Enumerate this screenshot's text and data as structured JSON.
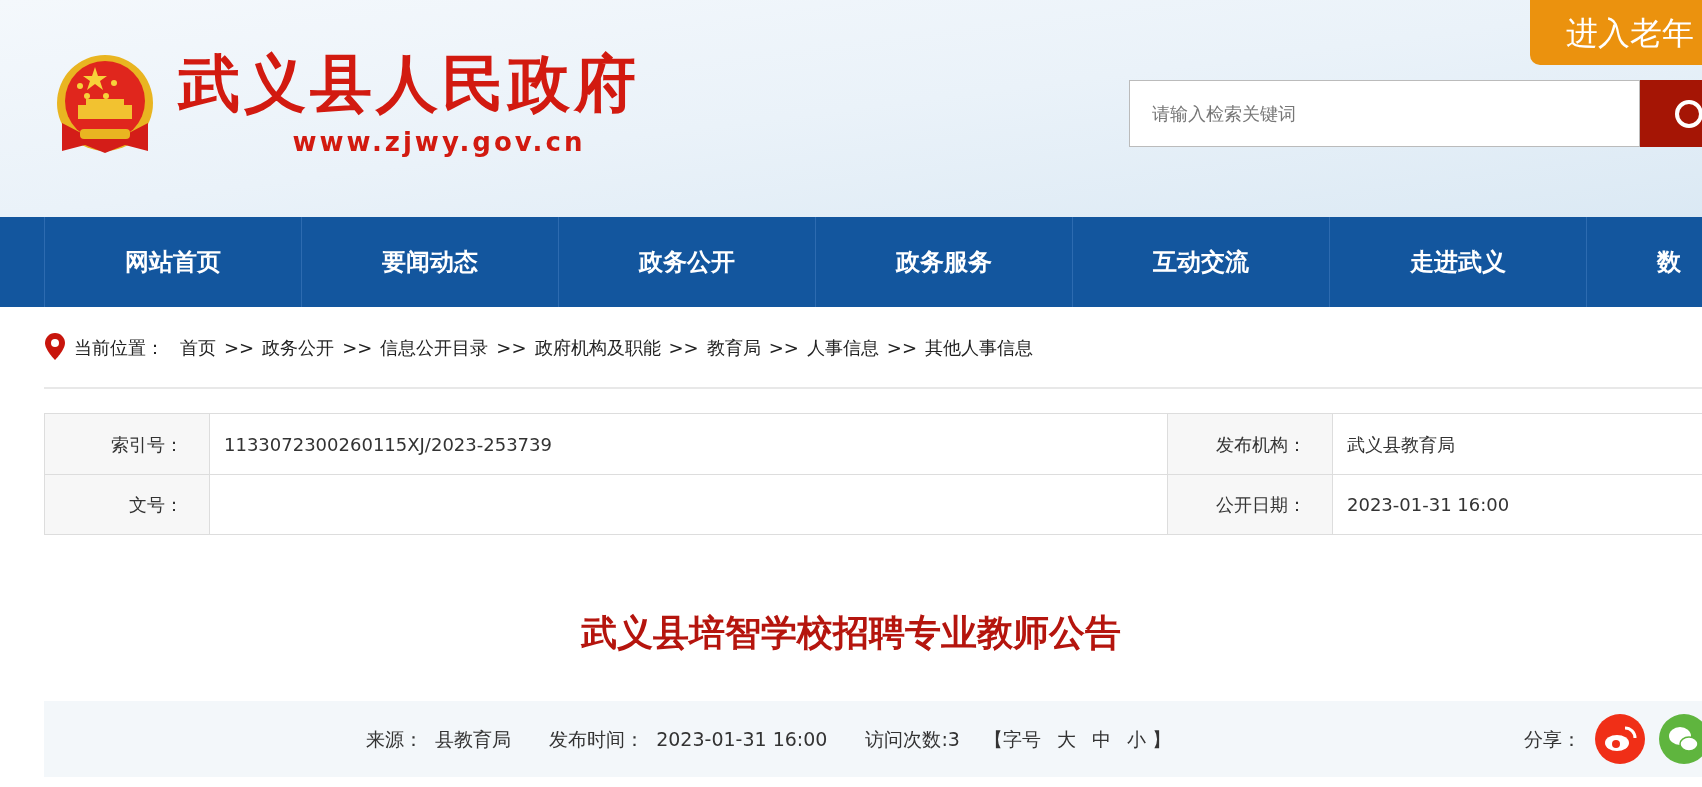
{
  "header": {
    "site_title": "武义县人民政府",
    "site_url": "www.zjwy.gov.cn",
    "elder_mode_button": "进入老年",
    "search": {
      "placeholder": "请输入检索关键词"
    }
  },
  "nav": [
    {
      "label": "网站首页"
    },
    {
      "label": "要闻动态"
    },
    {
      "label": "政务公开"
    },
    {
      "label": "政务服务"
    },
    {
      "label": "互动交流"
    },
    {
      "label": "走进武义"
    },
    {
      "label": "数"
    }
  ],
  "breadcrumb": {
    "label": "当前位置：",
    "items": [
      "首页",
      "政务公开",
      "信息公开目录",
      "政府机构及职能",
      "教育局",
      "人事信息",
      "其他人事信息"
    ],
    "separator": ">>"
  },
  "info_table": [
    [
      {
        "label": "索引号：",
        "value": "1133072300260115XJ/2023-253739"
      },
      {
        "label": "发布机构：",
        "value": "武义县教育局"
      }
    ],
    [
      {
        "label": "文号："
      },
      {
        "label": "公开日期：",
        "value": "2023-01-31 16:00"
      }
    ]
  ],
  "article": {
    "title": "武义县培智学校招聘专业教师公告",
    "meta": [
      {
        "label": "来源：",
        "value": "县教育局"
      },
      {
        "label": "发布时间：",
        "value": "2023-01-31 16:00"
      },
      {
        "label": "访问次数:",
        "value": "3"
      }
    ],
    "font_size": {
      "open": "【字号",
      "options": [
        "大",
        "中",
        "小"
      ],
      "close": "】"
    },
    "share_label": "分享："
  }
}
